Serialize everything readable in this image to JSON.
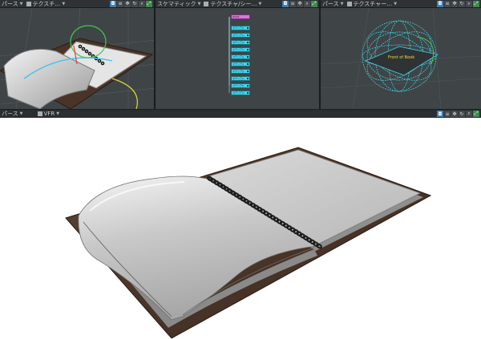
{
  "viewports": {
    "perspective": {
      "view_label": "パース",
      "shading_label": "テクスチ…",
      "tool_icons": [
        "camera-icon",
        "grid-icon",
        "move-view-icon",
        "rotate-view-icon",
        "zoom-icon",
        "fit-view-icon"
      ]
    },
    "schematic": {
      "view_label": "スケマティック",
      "shading_label": "テクスチャ/シー…",
      "tool_icons": [
        "camera-icon",
        "grid-icon",
        "move-view-icon",
        "zoom-icon",
        "fit-view-icon"
      ],
      "root_node": "ROOT",
      "child_node_label": "マテリアル",
      "child_node_count": 10
    },
    "perspective_2": {
      "view_label": "パース",
      "shading_label": "テクスチャー…",
      "tool_icons": [
        "camera-icon",
        "grid-icon",
        "move-view-icon",
        "rotate-view-icon",
        "zoom-icon",
        "fit-view-icon"
      ],
      "object_label": "Front of Book"
    }
  },
  "render_bar": {
    "view_label": "パース",
    "renderer_label": "VFR"
  },
  "colors": {
    "viewport_bg": "#3f4446",
    "toolbar_bg": "#2e3234",
    "node_cyan": "#44d4ea",
    "node_root": "#d57ad8",
    "cover_brown": "#4a3428",
    "page_gray": "#c8c8c8"
  }
}
